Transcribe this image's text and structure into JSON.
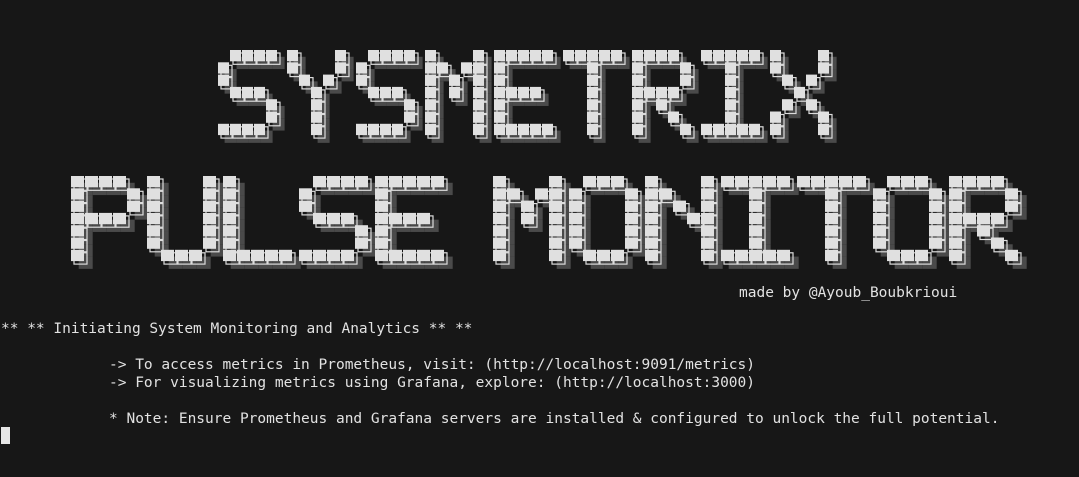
{
  "banner": {
    "line1": "SYSMETRIX",
    "line2": "PULSE MONITOR"
  },
  "credit": "made by @Ayoub_Boubkrioui",
  "heading": "** ** Initiating System Monitoring and Analytics ** **",
  "links": [
    "-> To access metrics in Prometheus, visit: (http://localhost:9091/metrics)",
    "-> For visualizing metrics using Grafana, explore: (http://localhost:3000)"
  ],
  "note": "* Note: Ensure Prometheus and Grafana servers are installed & configured to unlock the full potential.",
  "colors": {
    "background": "#171717",
    "text": "#e2e2e2",
    "banner_fill": "#e0e0e0",
    "banner_shadow": "#4a4a4a",
    "banner_outline": "#dcdcdc"
  }
}
